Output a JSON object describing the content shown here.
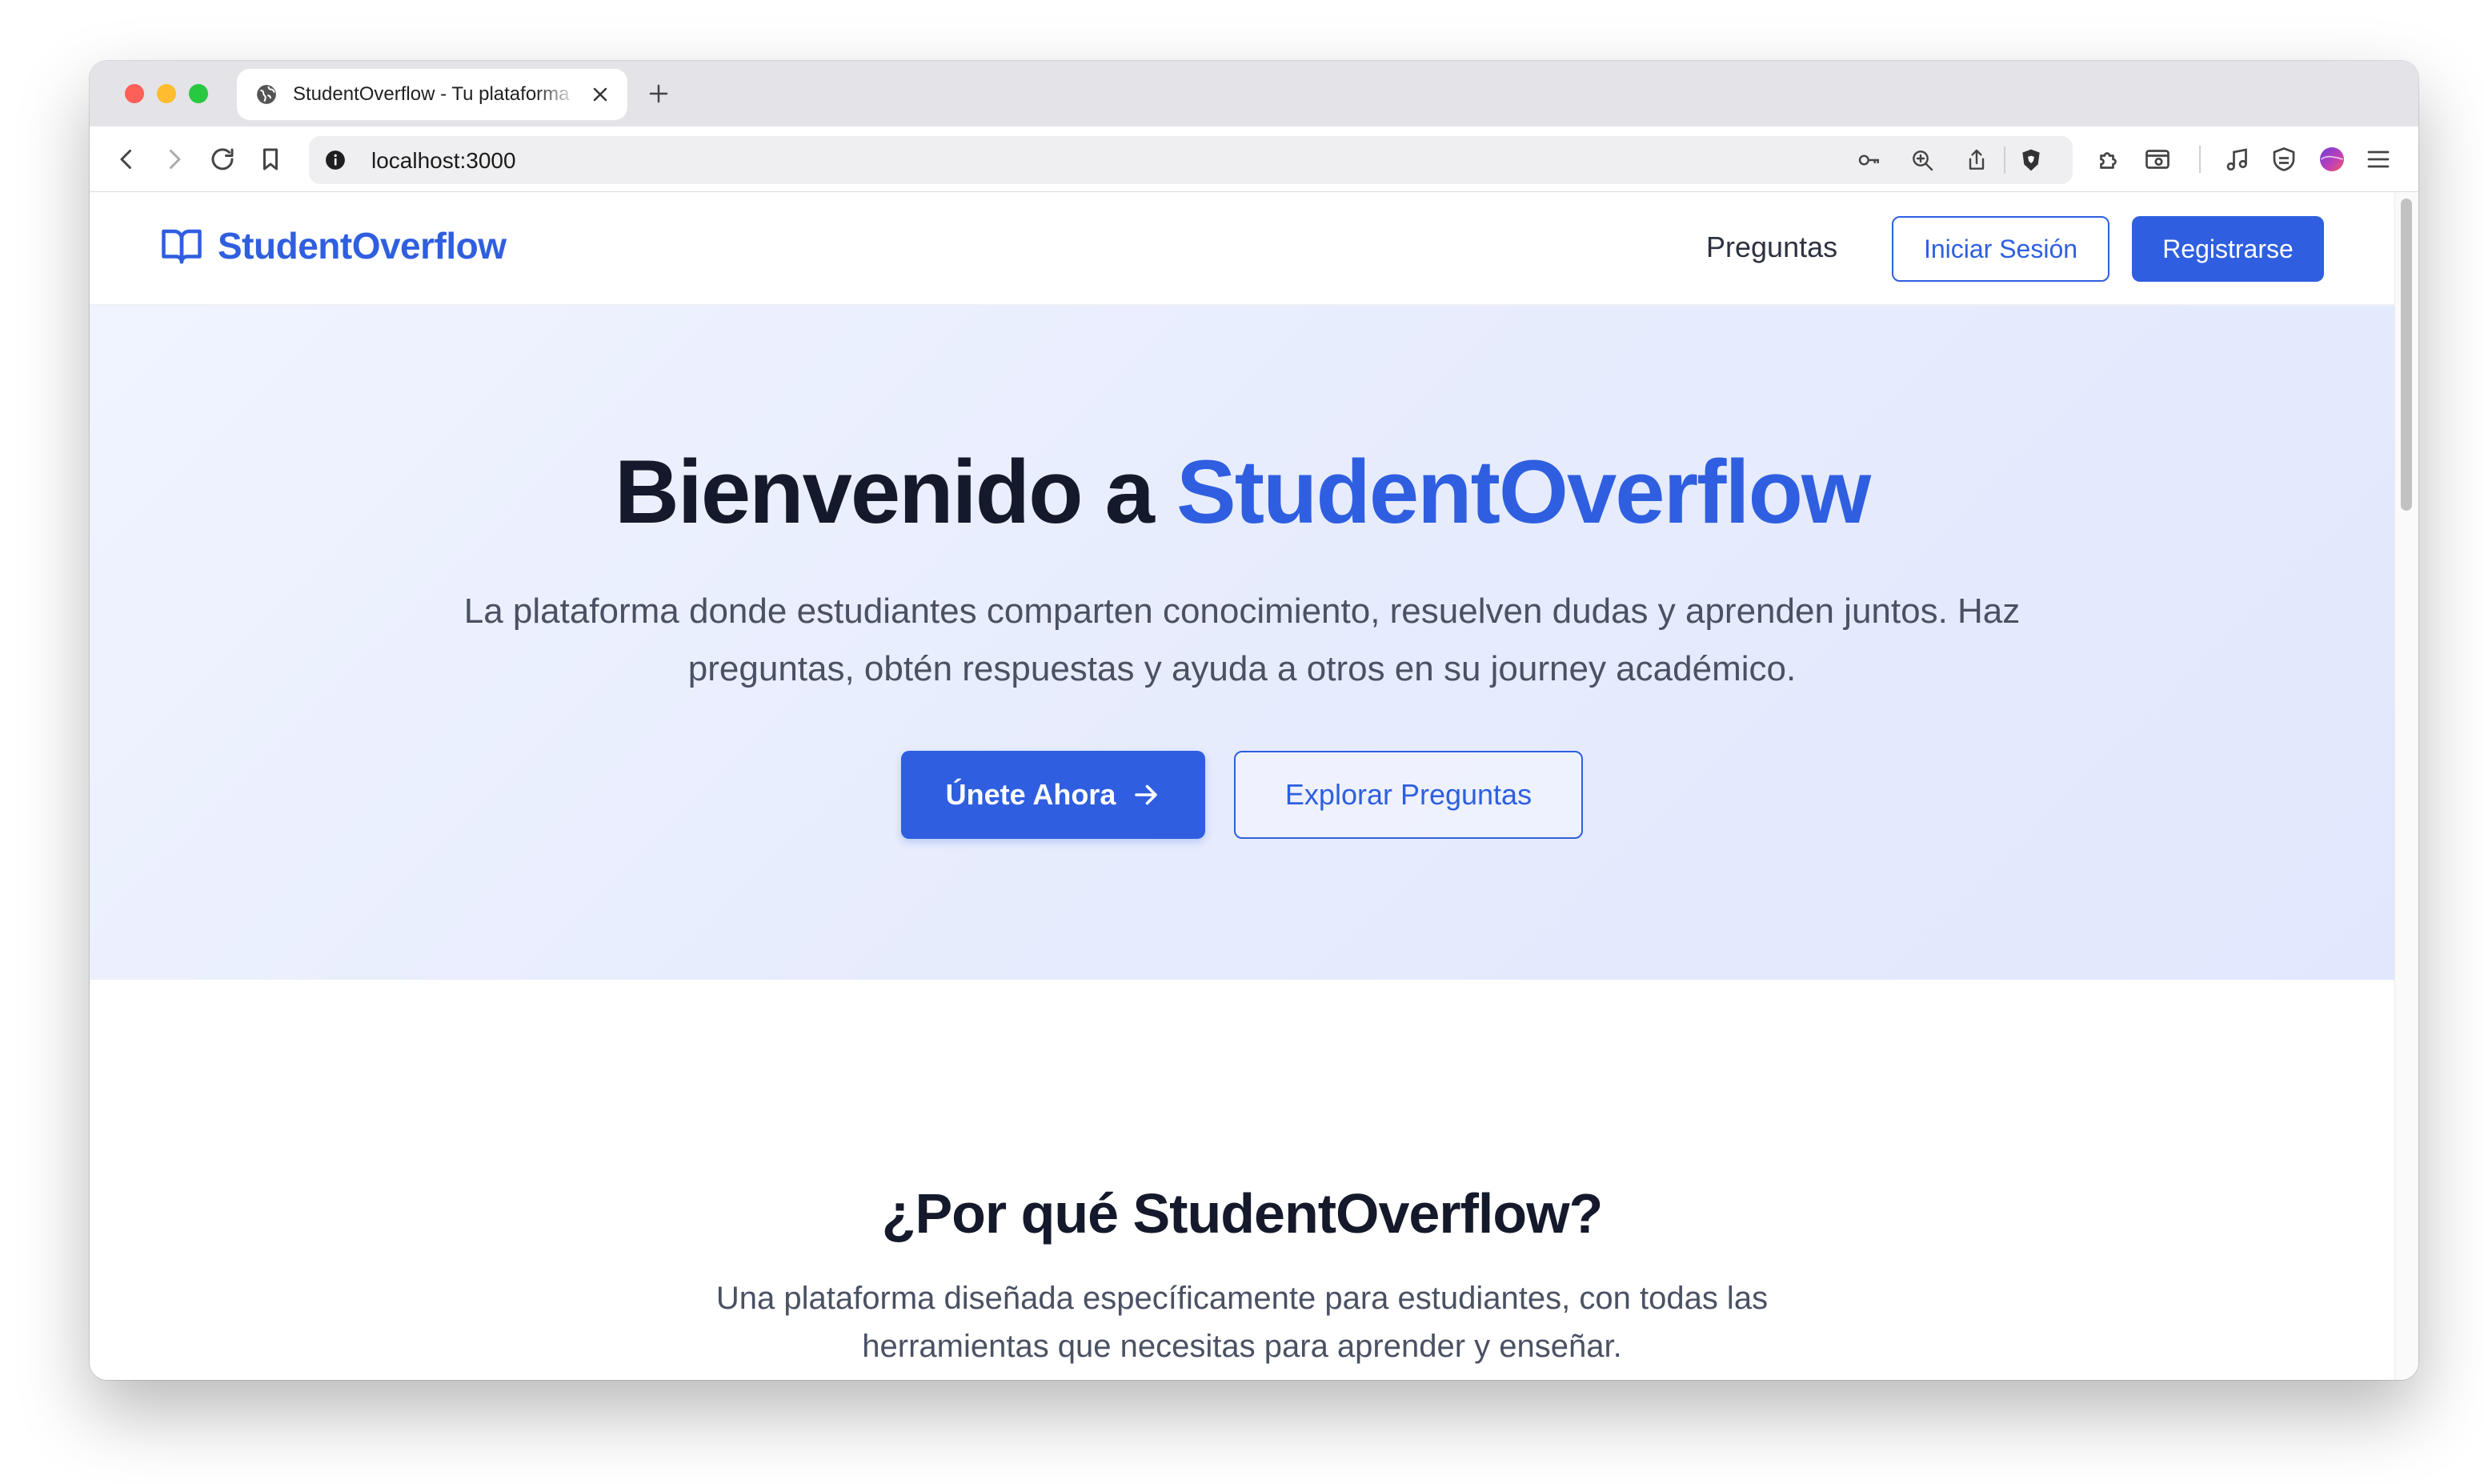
{
  "browser": {
    "tab_title": "StudentOverflow - Tu plataforma",
    "url": "localhost:3000"
  },
  "nav": {
    "brand": "StudentOverflow",
    "questions_link": "Preguntas",
    "login_button": "Iniciar Sesión",
    "register_button": "Registrarse"
  },
  "hero": {
    "title_prefix": "Bienvenido a ",
    "title_accent": "StudentOverflow",
    "subtitle": "La plataforma donde estudiantes comparten conocimiento, resuelven dudas y aprenden juntos. Haz preguntas, obtén respuestas y ayuda a otros en su journey académico.",
    "join_button": "Únete Ahora",
    "explore_button": "Explorar Preguntas"
  },
  "why": {
    "title": "¿Por qué StudentOverflow?",
    "subtitle": "Una plataforma diseñada específicamente para estudiantes, con todas las herramientas que necesitas para aprender y enseñar."
  },
  "colors": {
    "accent": "#2f5fe0",
    "heading": "#141a2b",
    "body_text": "#4a5163",
    "hero_bg": "#e7ecfd"
  },
  "icons": [
    "globe-icon",
    "close-icon",
    "plus-icon",
    "back-icon",
    "forward-icon",
    "reload-icon",
    "bookmark-icon",
    "info-icon",
    "key-icon",
    "zoom-icon",
    "share-icon",
    "brave-shield-icon",
    "extensions-icon",
    "sidebar-icon",
    "music-icon",
    "vpn-icon",
    "profile-icon",
    "menu-icon",
    "book-open-icon",
    "arrow-right-icon"
  ]
}
